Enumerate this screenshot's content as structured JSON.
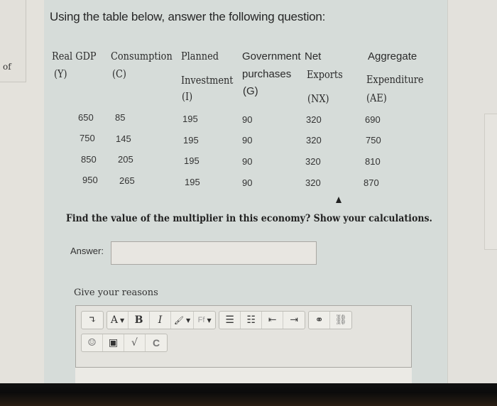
{
  "left_fragment": {
    "text": "of"
  },
  "title": "Using the table below, answer the following question:",
  "table": {
    "headers": [
      {
        "line1": "Real GDP",
        "line2": "(Y)"
      },
      {
        "line1": "Consumption",
        "line2": "(C)"
      },
      {
        "line1": "Planned",
        "line2": "Investment",
        "line3": "(I)"
      },
      {
        "line1": "Government",
        "line2": "purchases",
        "line3": "(G)"
      },
      {
        "line1": "Net",
        "line2": "Exports",
        "line3": "(NX)"
      },
      {
        "line1": "Aggregate",
        "line2": "Expenditure",
        "line3": "(AE)"
      }
    ],
    "rows": [
      [
        "650",
        "85",
        "195",
        "90",
        "320",
        "690"
      ],
      [
        "750",
        "145",
        "195",
        "90",
        "320",
        "750"
      ],
      [
        "850",
        "205",
        "195",
        "90",
        "320",
        "810"
      ],
      [
        "950",
        "265",
        "195",
        "90",
        "320",
        "870"
      ]
    ]
  },
  "question": "Find the value of the multiplier in this economy? Show your calculations.",
  "answer": {
    "label": "Answer:",
    "value": "",
    "placeholder": ""
  },
  "reasons": {
    "label": "Give your reasons",
    "toolbar": {
      "row1": [
        {
          "name": "toggle-toolbar",
          "glyph": "↴"
        },
        {
          "name": "font-color",
          "glyph": "A",
          "dropdown": true
        },
        {
          "name": "bold",
          "glyph": "B"
        },
        {
          "name": "italic",
          "glyph": "I"
        },
        {
          "name": "brush",
          "glyph": "🖌",
          "dropdown": true
        },
        {
          "name": "font-family",
          "glyph": "Ff",
          "dropdown": true
        },
        {
          "name": "unordered-list",
          "glyph": "☰"
        },
        {
          "name": "ordered-list",
          "glyph": "☷"
        },
        {
          "name": "outdent",
          "glyph": "⇤"
        },
        {
          "name": "indent",
          "glyph": "⇥"
        },
        {
          "name": "link",
          "glyph": "⚭"
        },
        {
          "name": "unlink",
          "glyph": "⛓"
        }
      ],
      "row2": [
        {
          "name": "emoticon",
          "glyph": "☺"
        },
        {
          "name": "image",
          "glyph": "▣"
        },
        {
          "name": "equation",
          "glyph": "√"
        },
        {
          "name": "char-map",
          "glyph": "C"
        }
      ]
    },
    "value": ""
  }
}
